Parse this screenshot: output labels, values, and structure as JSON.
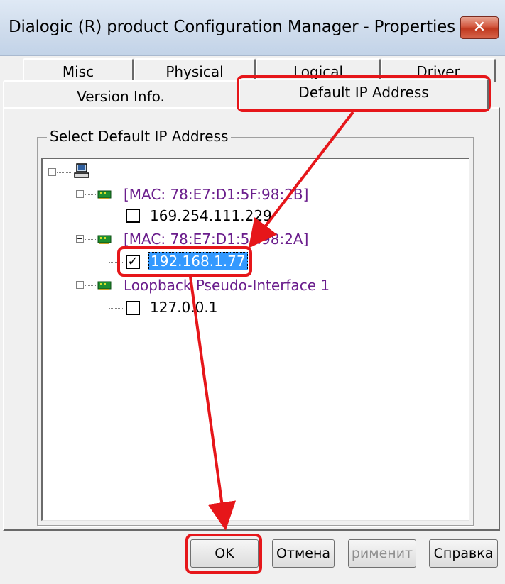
{
  "window": {
    "title": "Dialogic (R) product Configuration Manager - Properties ...",
    "close_label": "✕"
  },
  "tabs": {
    "row1": [
      "Misc",
      "Physical",
      "Logical",
      "Driver"
    ],
    "row2": [
      "Version Info.",
      "Default IP Address"
    ],
    "active": "Default IP Address"
  },
  "group": {
    "label": "Select Default IP Address"
  },
  "tree": {
    "root_icon": "computer-icon",
    "adapters": [
      {
        "label": "[MAC: 78:E7:D1:5F:98:2B]",
        "ip": "169.254.111.229",
        "checked": false
      },
      {
        "label": "[MAC: 78:E7:D1:5F:98:2A]",
        "ip": "192.168.1.77",
        "checked": true,
        "selected": true
      },
      {
        "label": "Loopback Pseudo-Interface 1",
        "ip": "127.0.0.1",
        "checked": false
      }
    ],
    "adapter_icon": "network-card-icon"
  },
  "buttons": {
    "ok": "OK",
    "cancel": "Отмена",
    "apply": "рименит",
    "help": "Справка"
  },
  "annotation_color": "#e6161a"
}
